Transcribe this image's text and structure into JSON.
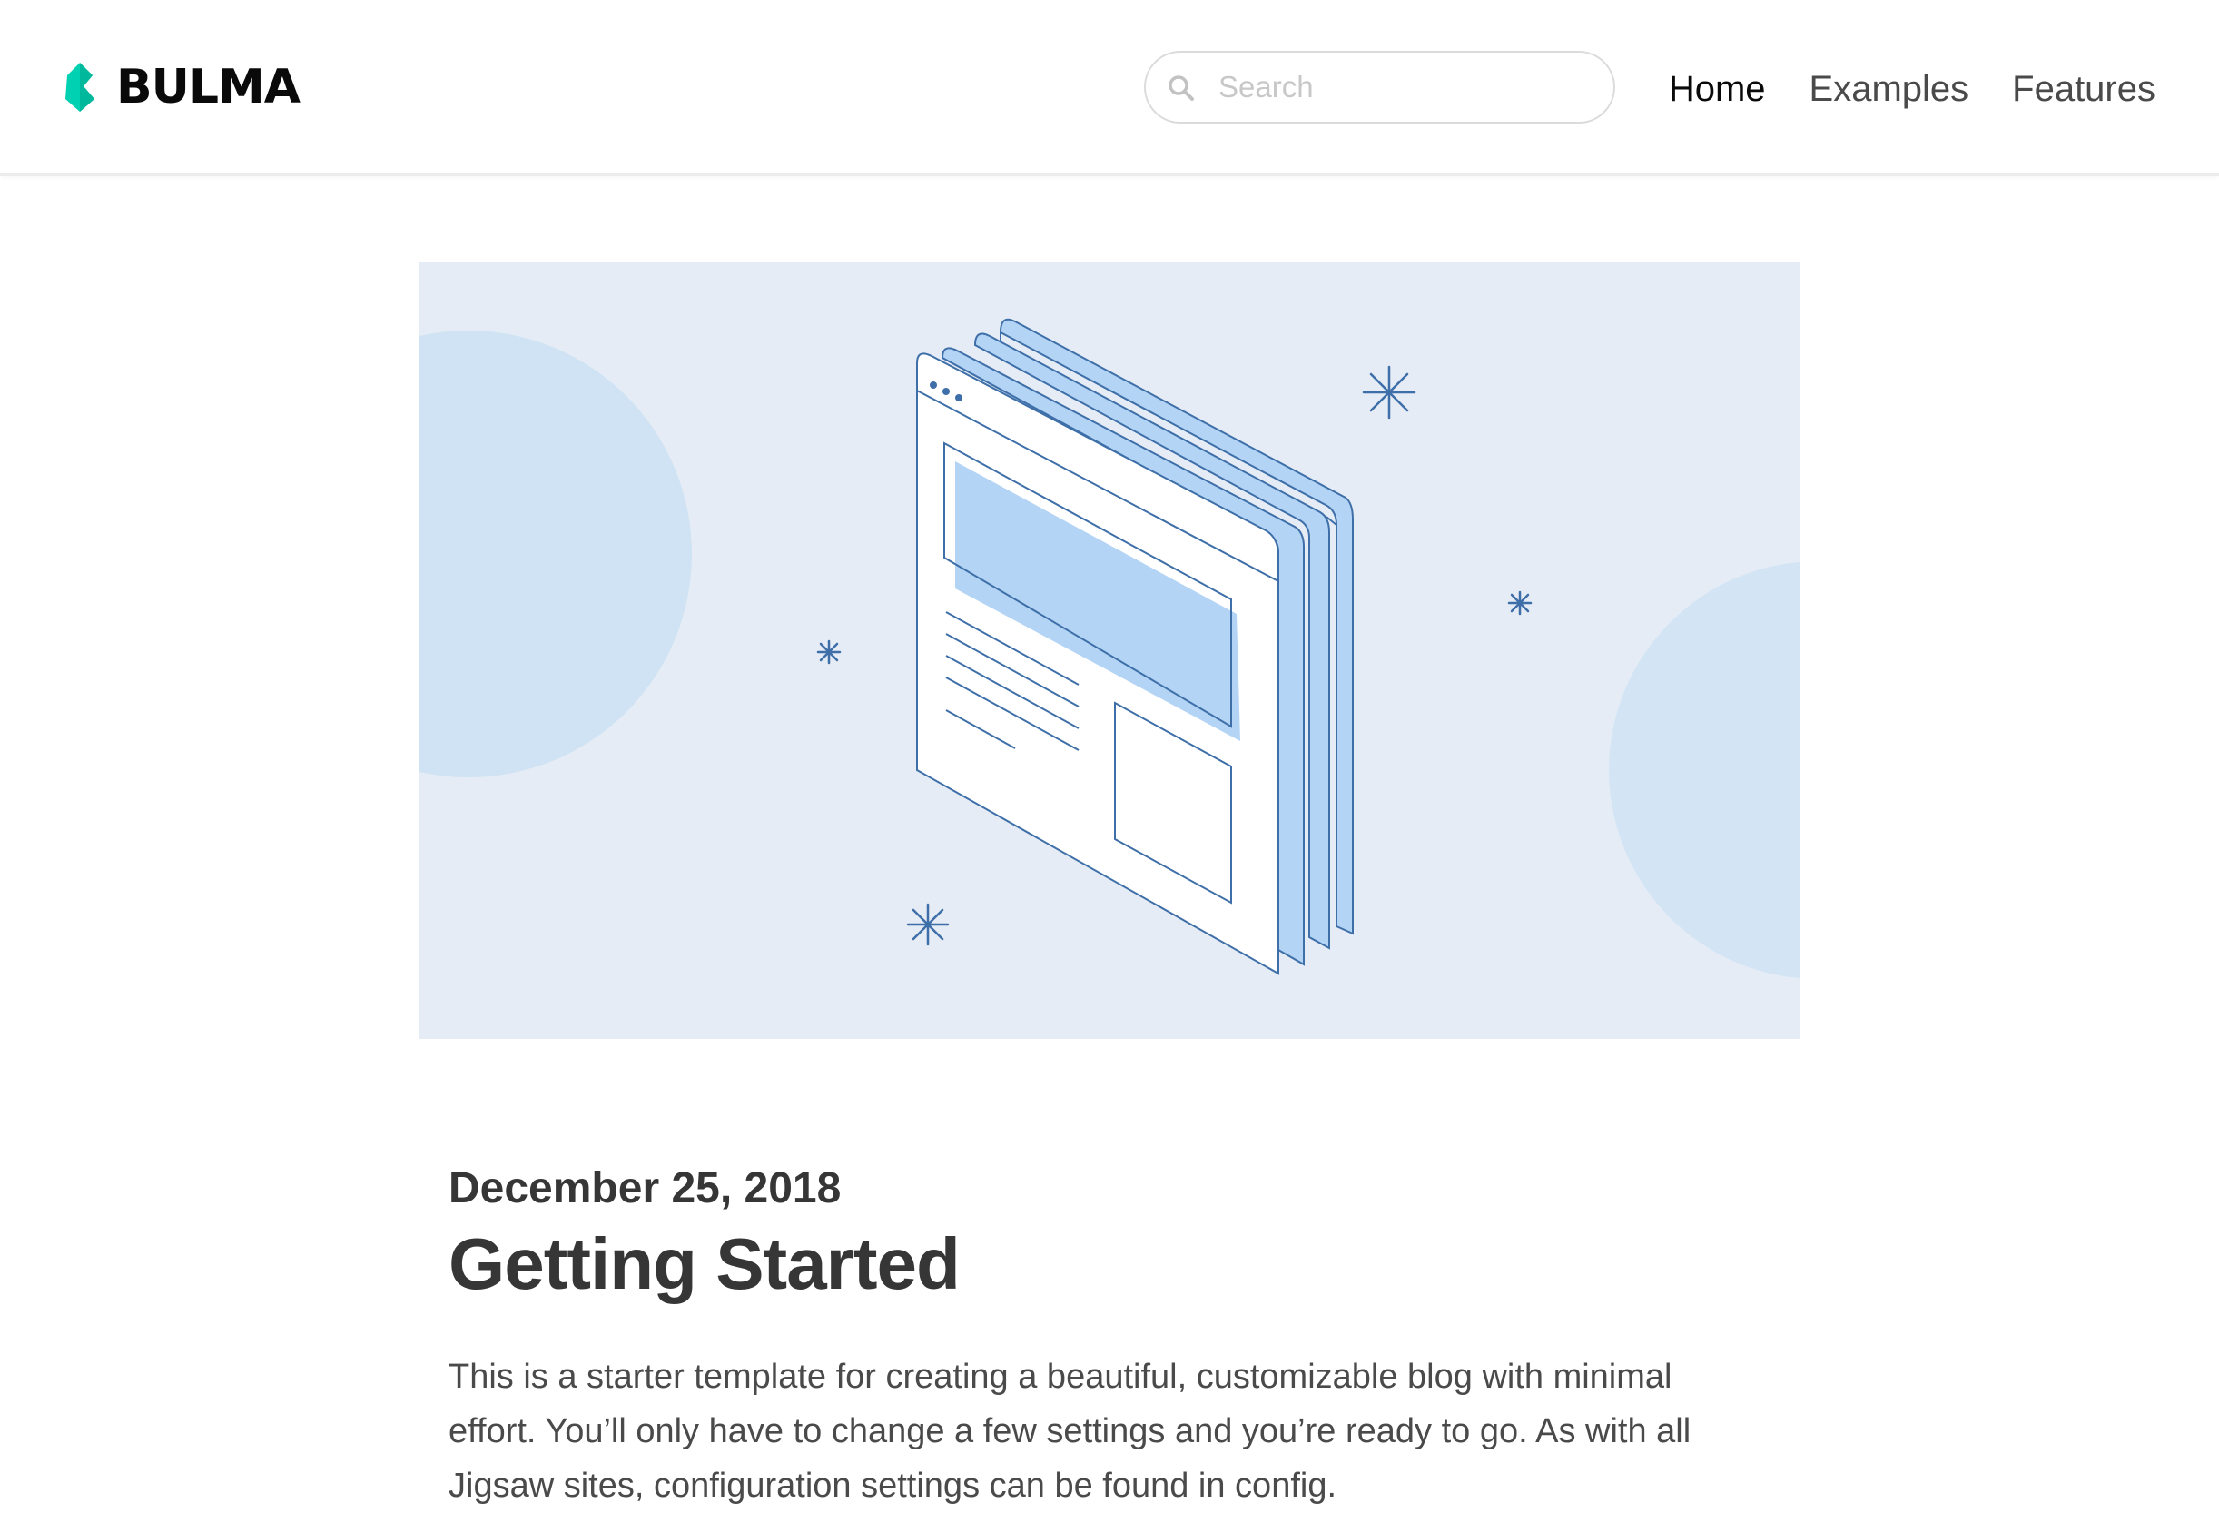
{
  "navbar": {
    "brand_name": "BULMA",
    "search_placeholder": "Search",
    "search_value": "",
    "items": [
      {
        "label": "Home",
        "active": true
      },
      {
        "label": "Examples",
        "active": false
      },
      {
        "label": "Features",
        "active": false
      }
    ]
  },
  "hero": {
    "icon": "browser-windows-illustration"
  },
  "post": {
    "date": "December 25, 2018",
    "title": "Getting Started",
    "excerpt": "This is a starter template for creating a beautiful, customizable blog with minimal effort. You’ll only have to change a few settings and you’re ready to go. As with all Jigsaw sites, configuration settings can be found in config."
  },
  "colors": {
    "brand": "#00d1b2",
    "hero_background": "#e5ecf5",
    "hero_circles": "#cfe3f4",
    "illustration_fill": "#b3d4f5",
    "illustration_stroke": "#3e6fa8"
  }
}
